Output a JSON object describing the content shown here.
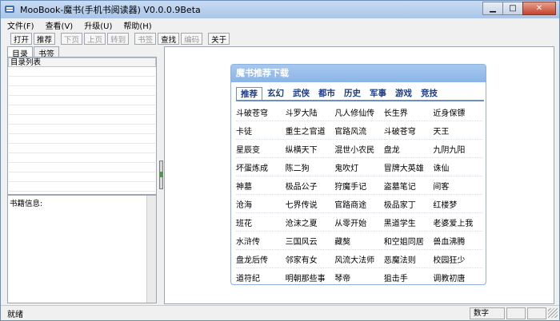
{
  "window": {
    "title": "MooBook-魔书(手机书阅读器) V0.0.0.9Beta"
  },
  "menu": [
    "文件(F)",
    "查看(V)",
    "升级(U)",
    "帮助(H)"
  ],
  "toolbar": [
    {
      "label": "打开",
      "enabled": true
    },
    {
      "label": "推荐",
      "enabled": true
    },
    {
      "label": "下页",
      "enabled": false
    },
    {
      "label": "上页",
      "enabled": false
    },
    {
      "label": "转到",
      "enabled": false
    },
    {
      "label": "书签",
      "enabled": false
    },
    {
      "label": "查找",
      "enabled": true
    },
    {
      "label": "编码",
      "enabled": false
    },
    {
      "label": "关于",
      "enabled": true
    }
  ],
  "left": {
    "tabs": [
      "目录",
      "书签"
    ],
    "toc_header": "目录列表",
    "info_label": "书籍信息:"
  },
  "recommend": {
    "title": "魔书推荐下载",
    "categories": [
      "推荐",
      "玄幻",
      "武侠",
      "都市",
      "历史",
      "军事",
      "游戏",
      "竞技"
    ],
    "books": [
      [
        "斗破苍穹",
        "斗罗大陆",
        "凡人修仙传",
        "长生界",
        "近身保镖"
      ],
      [
        "卡徒",
        "重生之官道",
        "官路风流",
        "斗破苍穹",
        "天王"
      ],
      [
        "星辰变",
        "纵横天下",
        "混世小农民",
        "盘龙",
        "九阴九阳"
      ],
      [
        "坏蛋炼成",
        "陈二狗",
        "鬼吹灯",
        "冒牌大英雄",
        "诛仙"
      ],
      [
        "神墓",
        "极品公子",
        "狩魔手记",
        "盗墓笔记",
        "间客"
      ],
      [
        "沧海",
        "七界传说",
        "官路商途",
        "极品家丁",
        "红楼梦"
      ],
      [
        "班花",
        "沧沫之夏",
        "从零开始",
        "黑道学生",
        "老婆爱上我"
      ],
      [
        "水浒传",
        "三国风云",
        "藏獒",
        "和空姐同居",
        "兽血沸腾"
      ],
      [
        "盘龙后传",
        "邻家有女",
        "风流大法师",
        "恶魔法则",
        "校园狂少"
      ],
      [
        "道符纪",
        "明朝那些事",
        "琴帝",
        "狙击手",
        "调教初唐"
      ]
    ]
  },
  "status": {
    "text": "就绪",
    "num_label": "数字"
  }
}
